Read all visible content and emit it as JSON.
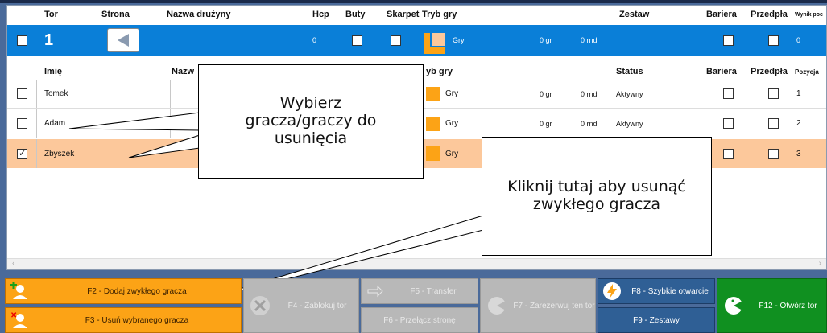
{
  "header1": {
    "tor": "Tor",
    "strona": "Strona",
    "nazwa": "Nazwa drużyny",
    "hcp": "Hcp",
    "buty": "Buty",
    "skarpet": "Skarpet",
    "tryb": "Tryb gry",
    "zestaw": "Zestaw",
    "bariera": "Bariera",
    "przedpla": "Przedpła",
    "wynik": "Wynik poc"
  },
  "lane": {
    "number": "1",
    "hcp": "0",
    "mode": "Gry",
    "gr": "0 gr",
    "rnd": "0 rnd",
    "wynik": "0"
  },
  "header2": {
    "imie": "Imię",
    "nazwa": "Nazw",
    "tryb": "yb gry",
    "status": "Status",
    "bariera": "Bariera",
    "przedpla": "Przedpła",
    "pozycja": "Pozycja"
  },
  "players": [
    {
      "name": "Tomek",
      "mode": "Gry",
      "gr": "0 gr",
      "rnd": "0 rnd",
      "status": "Aktywny",
      "pos": "1",
      "checked": false
    },
    {
      "name": "Adam",
      "mode": "Gry",
      "gr": "0 gr",
      "rnd": "0 rnd",
      "status": "Aktywny",
      "pos": "2",
      "checked": false
    },
    {
      "name": "Zbyszek",
      "mode": "Gry",
      "pos": "3",
      "checked": true
    }
  ],
  "callouts": {
    "select": "Wybierz gracza/graczy do usunięcia",
    "click": "Kliknij tutaj aby usunąć zwykłego gracza"
  },
  "buttons": {
    "f2": "F2 - Dodaj zwykłego gracza",
    "f3": "F3 - Usuń wybranego gracza",
    "f4": "F4 - Zablokuj tor",
    "f5": "F5 - Transfer",
    "f6": "F6 - Przełącz stronę",
    "f7": "F7 - Zarezerwuj ten tor",
    "f8": "F8 - Szybkie otwarcie",
    "f9": "F9 - Zestawy",
    "f12": "F12 - Otwórz tor"
  },
  "colors": {
    "lane_row": "#0a7fd8",
    "selected_row": "#fcc89b",
    "orange_btn": "#fca316",
    "green_btn": "#109020",
    "blue_btn": "#2f5f95"
  }
}
